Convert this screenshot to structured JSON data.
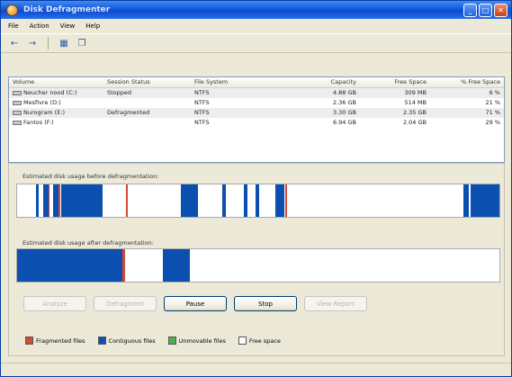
{
  "window": {
    "title": "Disk Defragmenter"
  },
  "menu": [
    "File",
    "Action",
    "View",
    "Help"
  ],
  "table": {
    "headers": [
      "Volume",
      "Session Status",
      "File System",
      "Capacity",
      "Free Space",
      "% Free Space"
    ],
    "rows": [
      [
        "Neucher nood (C:)",
        "Stopped",
        "NTFS",
        "4.88 GB",
        "309 MB",
        "6 %"
      ],
      [
        "Mesfivre (D:)",
        "",
        "NTFS",
        "2.36 GB",
        "514 MB",
        "21 %"
      ],
      [
        "Nurogram (E:)",
        "Defragmented",
        "NTFS",
        "3.30 GB",
        "2.35 GB",
        "71 %"
      ],
      [
        "Fantos (F:)",
        "",
        "NTFS",
        "6.94 GB",
        "2.04 GB",
        "29 %"
      ]
    ]
  },
  "before": {
    "label": "Estimated disk usage before defragmentation:",
    "segments": [
      {
        "t": "contig",
        "s": 0.04,
        "e": 0.045
      },
      {
        "t": "contig",
        "s": 0.055,
        "e": 0.065
      },
      {
        "t": "frag",
        "s": 0.065,
        "e": 0.068
      },
      {
        "t": "contig",
        "s": 0.075,
        "e": 0.085
      },
      {
        "t": "frag",
        "s": 0.086,
        "e": 0.09
      },
      {
        "t": "contig",
        "s": 0.092,
        "e": 0.178
      },
      {
        "t": "frag",
        "s": 0.225,
        "e": 0.229
      },
      {
        "t": "contig",
        "s": 0.34,
        "e": 0.375
      },
      {
        "t": "contig",
        "s": 0.425,
        "e": 0.432
      },
      {
        "t": "contig",
        "s": 0.47,
        "e": 0.477
      },
      {
        "t": "contig",
        "s": 0.495,
        "e": 0.502
      },
      {
        "t": "contig",
        "s": 0.535,
        "e": 0.555
      },
      {
        "t": "frag",
        "s": 0.556,
        "e": 0.56
      },
      {
        "t": "contig",
        "s": 0.925,
        "e": 0.937
      },
      {
        "t": "contig",
        "s": 0.94,
        "e": 1.0
      }
    ]
  },
  "after": {
    "label": "Estimated disk usage after defragmentation:",
    "segments": [
      {
        "t": "contig",
        "s": 0.0,
        "e": 0.218
      },
      {
        "t": "frag",
        "s": 0.218,
        "e": 0.224
      },
      {
        "t": "contig",
        "s": 0.302,
        "e": 0.358
      }
    ]
  },
  "buttons": {
    "analyze": "Analyze",
    "defragment": "Defragment",
    "pause": "Pause",
    "stop": "Stop",
    "view_report": "View Report"
  },
  "legend": {
    "fragmented": "Fragmented files",
    "contiguous": "Contiguous files",
    "unmovable": "Unmovable files",
    "free": "Free space"
  },
  "colors": {
    "fragmented": "#d14a33",
    "contiguous": "#0b4fb0",
    "unmovable": "#4caf50",
    "free": "#ffffff"
  }
}
